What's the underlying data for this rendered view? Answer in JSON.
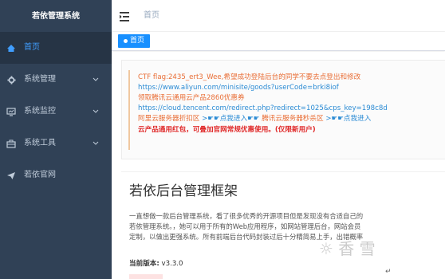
{
  "sidebar": {
    "logo": "若依管理系统",
    "items": [
      {
        "label": "首页",
        "icon": "home-icon",
        "has_chevron": false,
        "active": true
      },
      {
        "label": "系统管理",
        "icon": "gear-icon",
        "has_chevron": true,
        "active": false
      },
      {
        "label": "系统监控",
        "icon": "monitor-icon",
        "has_chevron": true,
        "active": false
      },
      {
        "label": "系统工具",
        "icon": "toolbox-icon",
        "has_chevron": true,
        "active": false
      },
      {
        "label": "若依官网",
        "icon": "send-icon",
        "has_chevron": false,
        "active": false
      }
    ]
  },
  "navbar": {
    "breadcrumb": "首页"
  },
  "tags": [
    {
      "label": "首页",
      "active": true
    }
  ],
  "notice": {
    "line1": "CTF flag:2435_ert3_Wee,希望成功登陆后台的同学不要去点登出和修改",
    "line2": "https://www.aliyun.com/minisite/goods?userCode=brki8iof",
    "line3": "领取腾讯云通用云产品2860优惠券",
    "line4": "https://cloud.tencent.com/redirect.php?redirect=1025&cps_key=198c8d",
    "line5a": "阿里云服务器折扣区",
    "line5b": ">☛☛点我进入☛☛",
    "line5c": "腾讯云服务器秒杀区",
    "line5d": ">☛☛点我进入",
    "line6": "云产品通用红包，可叠加官网常规优惠使用。(仅限新用户)"
  },
  "main": {
    "title": "若依后台管理框架",
    "desc1": "一直想做一款后台管理系统，看了很多优秀的开源项目但是发现没有合适自己的",
    "desc2": "若依管理系统。，她可以用于所有的Web应用程序，如网站管理后台，网站会员",
    "desc3": "定制，以做出更强系统。所有前端后台代码封装过后十分精简易上手，出错概率",
    "version_label": "当前版本:",
    "version_value": "v3.3.0"
  },
  "watermark": "☼ 香 雪",
  "colors": {
    "sidebar_bg": "#304156",
    "sidebar_active_bg": "#263445",
    "sidebar_active_text": "#409eff",
    "tag_active_bg": "#1890ff",
    "notice_orange": "#e96e36",
    "notice_blue": "#2b8bd4",
    "notice_red": "#e02a2a"
  }
}
